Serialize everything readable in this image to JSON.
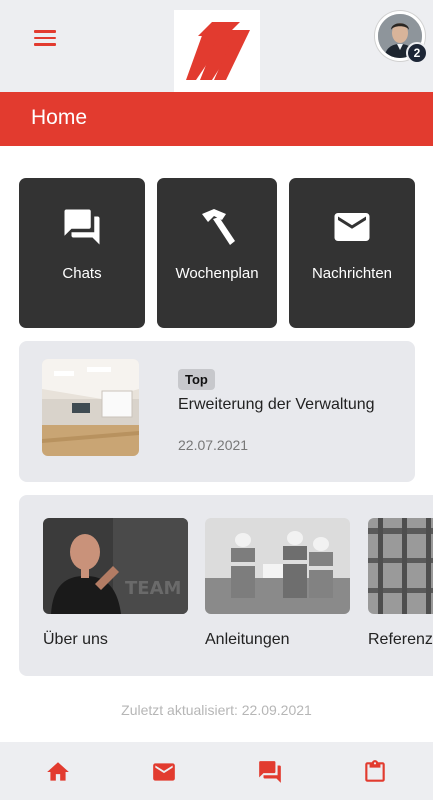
{
  "header": {
    "menu_icon": "hamburger-menu-icon",
    "logo": "company-logo",
    "avatar_badge_count": "2",
    "page_title": "Home"
  },
  "colors": {
    "accent": "#e23b2f",
    "tile_bg": "#333333",
    "card_bg": "#e8e9ed",
    "badge_bg": "#1d2636"
  },
  "tiles": [
    {
      "label": "Chats",
      "icon": "chat-bubbles-icon"
    },
    {
      "label": "Wochenplan",
      "icon": "hammer-icon"
    },
    {
      "label": "Nachrichten",
      "icon": "mail-icon"
    }
  ],
  "news": {
    "tag": "Top",
    "title": "Erweiterung der Verwaltung",
    "date": "22.07.2021"
  },
  "categories": [
    {
      "label": "Über uns"
    },
    {
      "label": "Anleitungen"
    },
    {
      "label": "Referenzen"
    }
  ],
  "footer": {
    "updated": "Zuletzt aktualisiert: 22.09.2021"
  },
  "bottom_nav": [
    {
      "icon": "home-icon"
    },
    {
      "icon": "mail-icon"
    },
    {
      "icon": "chat-icon"
    },
    {
      "icon": "clipboard-icon"
    }
  ]
}
